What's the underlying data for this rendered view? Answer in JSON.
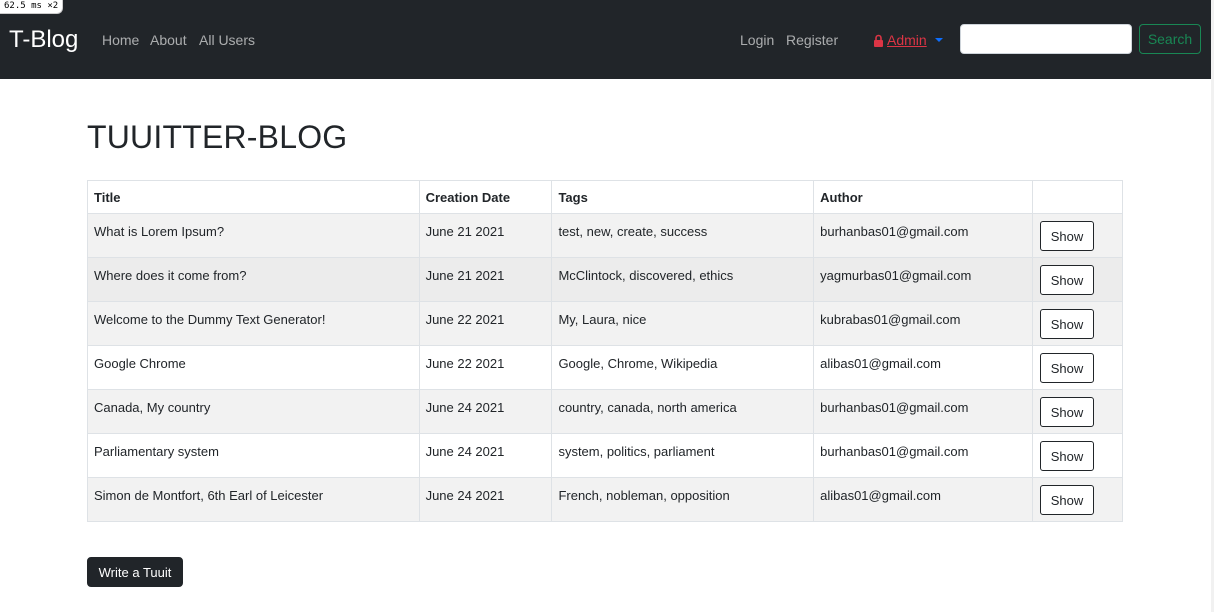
{
  "debug": {
    "timing": "62.5",
    "unit": "ms",
    "multiplier": "×2"
  },
  "navbar": {
    "brand": "T-Blog",
    "links": [
      {
        "label": "Home"
      },
      {
        "label": "About"
      },
      {
        "label": "All Users"
      }
    ],
    "auth_links": [
      {
        "label": "Login"
      },
      {
        "label": "Register"
      }
    ],
    "admin": {
      "label": "Admin",
      "icon": "lock-icon",
      "color": "#dc3545"
    },
    "search": {
      "value": "",
      "placeholder": "",
      "button_label": "Search",
      "button_color": "#198754"
    }
  },
  "main": {
    "title": "TUUITTER-BLOG",
    "table": {
      "columns": [
        "Title",
        "Creation Date",
        "Tags",
        "Author",
        ""
      ],
      "rows": [
        {
          "title": "What is Lorem Ipsum?",
          "date": "June 21 2021",
          "tags": "test, new, create, success",
          "author": "burhanbas01@gmail.com",
          "action": "Show"
        },
        {
          "title": "Where does it come from?",
          "date": "June 21 2021",
          "tags": "McClintock, discovered, ethics",
          "author": "yagmurbas01@gmail.com",
          "action": "Show"
        },
        {
          "title": "Welcome to the Dummy Text Generator!",
          "date": "June 22 2021",
          "tags": "My, Laura, nice",
          "author": "kubrabas01@gmail.com",
          "action": "Show"
        },
        {
          "title": "Google Chrome",
          "date": "June 22 2021",
          "tags": "Google, Chrome, Wikipedia",
          "author": "alibas01@gmail.com",
          "action": "Show"
        },
        {
          "title": "Canada, My country",
          "date": "June 24 2021",
          "tags": "country, canada, north america",
          "author": "burhanbas01@gmail.com",
          "action": "Show"
        },
        {
          "title": "Parliamentary system",
          "date": "June 24 2021",
          "tags": "system, politics, parliament",
          "author": "burhanbas01@gmail.com",
          "action": "Show"
        },
        {
          "title": "Simon de Montfort, 6th Earl of Leicester",
          "date": "June 24 2021",
          "tags": "French, nobleman, opposition",
          "author": "alibas01@gmail.com",
          "action": "Show"
        }
      ]
    },
    "write_button": "Write a Tuuit"
  }
}
